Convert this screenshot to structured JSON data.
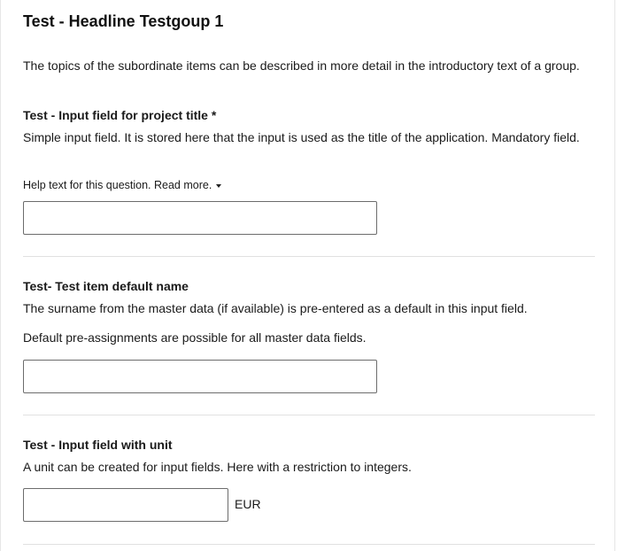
{
  "group": {
    "title": "Test - Headline Testgoup 1",
    "intro": "The topics of the subordinate items can be described in more detail in the introductory text of a group."
  },
  "questions": [
    {
      "title": "Test - Input field for project title *",
      "description": "Simple input field. It is stored here that the input is used as the title of the application. Mandatory field.",
      "help_text": "Help text for this question. Read more.",
      "value": "",
      "placeholder": ""
    },
    {
      "title": "Test- Test item default name",
      "description": "The surname from the master data (if available) is pre-entered as a default in this input field.",
      "description_2": "Default pre-assignments are possible for all master data fields.",
      "value": "",
      "placeholder": ""
    },
    {
      "title": "Test - Input field with unit",
      "description": "A unit can be created for input fields. Here with a restriction to integers.",
      "value": "",
      "placeholder": "",
      "unit": "EUR"
    }
  ],
  "icons": {
    "help_toggle": "caret-down-icon"
  }
}
